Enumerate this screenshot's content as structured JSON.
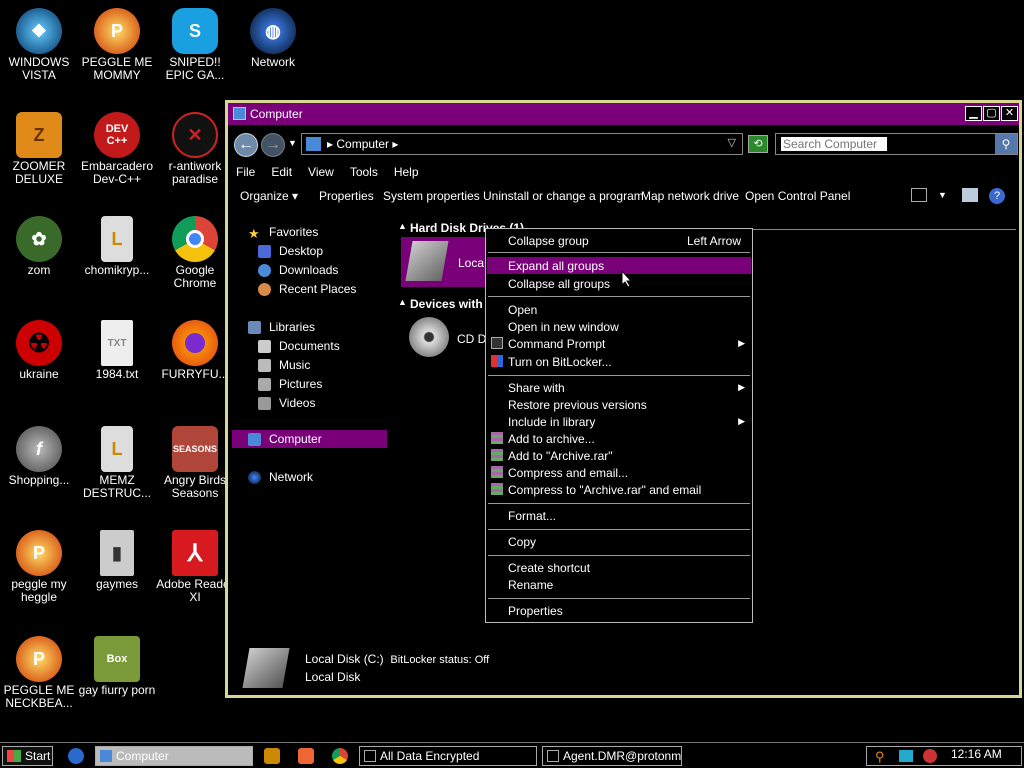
{
  "desktop_icons": [
    {
      "label": "WINDOWS VISTA",
      "icon": "windows-vista-orb-icon"
    },
    {
      "label": "PEGGLE ME MOMMY",
      "icon": "peggle-icon"
    },
    {
      "label": "SNIPED!! EPIC GA...",
      "icon": "skype-icon"
    },
    {
      "label": "Network",
      "icon": "network-globe-icon"
    },
    {
      "label": "ZOOMER DELUXE",
      "icon": "zuma-icon"
    },
    {
      "label": "Embarcadero Dev-C++",
      "icon": "devcpp-icon"
    },
    {
      "label": "r-antiwork paradise",
      "icon": "r-antiwork-icon"
    },
    {
      "label": "zom",
      "icon": "flower-zombie-icon"
    },
    {
      "label": "chomikryp...",
      "icon": "file-shortcut-icon"
    },
    {
      "label": "Google Chrome",
      "icon": "chrome-icon"
    },
    {
      "label": "ukraine",
      "icon": "radiation-icon"
    },
    {
      "label": "1984.txt",
      "icon": "text-file-icon"
    },
    {
      "label": "FURRYFU...",
      "icon": "firefox-icon"
    },
    {
      "label": "Shopping...",
      "icon": "flash-icon"
    },
    {
      "label": "MEMZ DESTRUC...",
      "icon": "file-shortcut-icon"
    },
    {
      "label": "Angry Birds Seasons",
      "icon": "angry-birds-icon"
    },
    {
      "label": "peggle my heggle",
      "icon": "peggle-icon"
    },
    {
      "label": "gaymes",
      "icon": "folder-icon"
    },
    {
      "label": "Adobe Reader XI",
      "icon": "adobe-reader-icon"
    },
    {
      "label": "PEGGLE ME NECKBEA...",
      "icon": "peggle-icon"
    },
    {
      "label": "gay fiurry porn",
      "icon": "box-beaver-icon"
    }
  ],
  "window": {
    "title": "Computer",
    "address": "Computer",
    "search_placeholder": "Search Computer",
    "menu": [
      "File",
      "Edit",
      "View",
      "Tools",
      "Help"
    ],
    "commands": [
      "Organize",
      "Properties",
      "System properties",
      "Uninstall or change a program",
      "Map network drive",
      "Open Control Panel"
    ],
    "nav": {
      "favorites": "Favorites",
      "favorites_items": [
        "Desktop",
        "Downloads",
        "Recent Places"
      ],
      "libraries": "Libraries",
      "libraries_items": [
        "Documents",
        "Music",
        "Pictures",
        "Videos"
      ],
      "computer": "Computer",
      "network": "Network"
    },
    "groups": {
      "hdd": "Hard Disk Drives (1)",
      "hdd_item": "Loca",
      "devices": "Devices with",
      "cd_item": "CD D"
    },
    "details": {
      "name": "Local Disk (C:)",
      "bitlocker": "BitLocker status: Off",
      "type": "Local Disk"
    }
  },
  "context_menu": {
    "items": [
      {
        "label": "Collapse group",
        "shortcut": "Left Arrow"
      },
      {
        "label": "Expand all groups",
        "highlighted": true
      },
      {
        "label": "Collapse all groups"
      },
      {
        "label": "Open"
      },
      {
        "label": "Open in new window"
      },
      {
        "label": "Command Prompt",
        "submenu": true
      },
      {
        "label": "Turn on BitLocker..."
      },
      {
        "label": "Share with",
        "submenu": true
      },
      {
        "label": "Restore previous versions"
      },
      {
        "label": "Include in library",
        "submenu": true
      },
      {
        "label": "Add to archive..."
      },
      {
        "label": "Add to \"Archive.rar\""
      },
      {
        "label": "Compress and email..."
      },
      {
        "label": "Compress to \"Archive.rar\" and email"
      },
      {
        "label": "Format..."
      },
      {
        "label": "Copy"
      },
      {
        "label": "Create shortcut"
      },
      {
        "label": "Rename"
      },
      {
        "label": "Properties"
      }
    ]
  },
  "taskbar": {
    "start": "Start",
    "tasks": [
      "Computer",
      "All Data Encrypted",
      "Agent.DMR@protonmail...."
    ],
    "clock": "12:16 AM"
  },
  "colors": {
    "accent": "#7a007a",
    "window_border": "#d8d890"
  }
}
